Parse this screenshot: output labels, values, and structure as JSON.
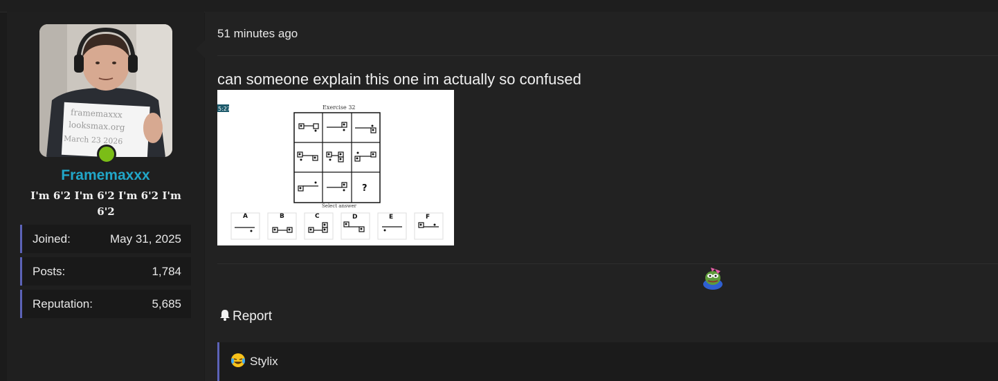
{
  "user": {
    "username": "Framemaxxx",
    "title": "I'm 6'2 I'm 6'2 I'm 6'2 I'm 6'2",
    "status_color": "#7bbd17",
    "username_color": "#21a7c9",
    "stats": [
      {
        "label": "Joined:",
        "value": "May 31, 2025"
      },
      {
        "label": "Posts:",
        "value": "1,784"
      },
      {
        "label": "Reputation:",
        "value": "5,685"
      }
    ],
    "avatar_sign": [
      "framemaxxx",
      "looksmax.org",
      "March 23 2026"
    ]
  },
  "post": {
    "timestamp": "51 minutes ago",
    "message": "can someone explain this one im actually so confused",
    "attachment": {
      "video_time": "5:27",
      "caption": "Exercise 32",
      "question_mark": "?",
      "select_text": "Select answer",
      "options": [
        "A",
        "B",
        "C",
        "D",
        "E",
        "F"
      ]
    },
    "actions": {
      "report_label": "Report",
      "report_icon": "bell-icon"
    },
    "reactions": {
      "reaction_icon": "pepe-sticker-icon",
      "summary_icon": "crying-laughing-emoji",
      "users": "Stylix"
    }
  },
  "colors": {
    "accent_border": "#5c63b8",
    "background": "#1b1b1b",
    "post_background": "#222222"
  }
}
